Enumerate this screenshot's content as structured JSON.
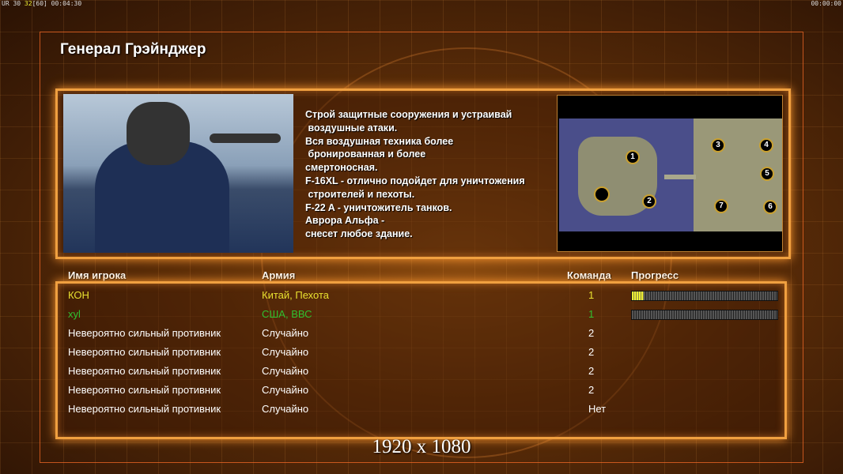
{
  "hud": {
    "left_prefix": "UR 30",
    "left_fps": "32",
    "left_cap": "[60]",
    "left_time": "00:04:30",
    "right_time": "00:00:00"
  },
  "title": "Генерал Грэйнджер",
  "description": "Строй защитные сооружения и устраивай\n воздушные атаки.\nВся воздушная техника более\n бронированная и более\nсмертоносная.\nF-16XL - отлично подойдет для уничтожения\n строителей и пехоты.\nF-22 A - уничтожитель танков.\nАврора Альфа -\nснесет любое здание.",
  "map": {
    "spots": [
      "1",
      "2",
      "3",
      "4",
      "5",
      "6",
      "7"
    ]
  },
  "table": {
    "headers": {
      "name": "Имя игрока",
      "army": "Армия",
      "team": "Команда",
      "progress": "Прогресс"
    },
    "rows": [
      {
        "name": "КОН",
        "army": "Китай, Пехота",
        "team": "1",
        "color": "#e8e030",
        "progress": 0.08
      },
      {
        "name": "xyl",
        "army": "США, ВВС",
        "team": "1",
        "color": "#30c030",
        "progress": 0
      },
      {
        "name": "Невероятно сильный противник",
        "army": "Случайно",
        "team": "2",
        "color": "#ffffff"
      },
      {
        "name": "Невероятно сильный противник",
        "army": "Случайно",
        "team": "2",
        "color": "#ffffff"
      },
      {
        "name": "Невероятно сильный противник",
        "army": "Случайно",
        "team": "2",
        "color": "#ffffff"
      },
      {
        "name": "Невероятно сильный противник",
        "army": "Случайно",
        "team": "2",
        "color": "#ffffff"
      },
      {
        "name": "Невероятно сильный противник",
        "army": "Случайно",
        "team": "Нет",
        "color": "#ffffff"
      }
    ]
  },
  "resolution": "1920 x 1080"
}
